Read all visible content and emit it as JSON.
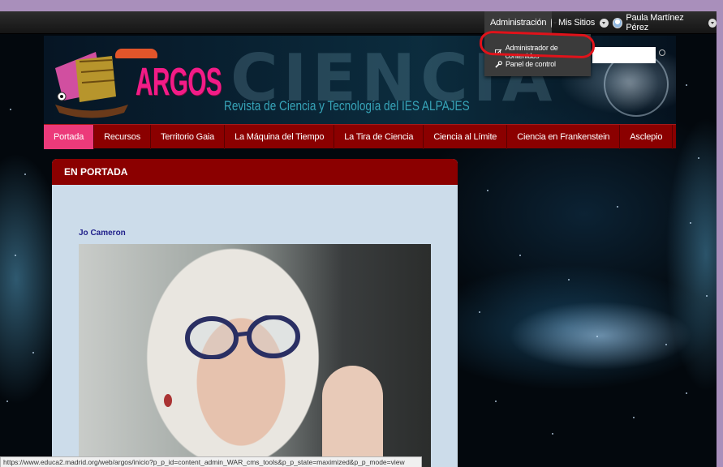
{
  "dockbar": {
    "admin_label": "Administración",
    "sites_label": "Mis Sitios",
    "user_name": "Paula Martínez Pérez"
  },
  "admin_menu": {
    "items": [
      {
        "label": "Administrador de contenidos",
        "icon": "edit-icon"
      },
      {
        "label": "Panel de control",
        "icon": "wrench-icon"
      }
    ]
  },
  "banner": {
    "logo": "ARGOS",
    "subtitle": "Revista de Ciencia y Tecnología del IES ALPAJES"
  },
  "nav": {
    "items": [
      {
        "label": "Portada",
        "active": true
      },
      {
        "label": "Recursos"
      },
      {
        "label": "Territorio Gaia"
      },
      {
        "label": "La Máquina del Tiempo"
      },
      {
        "label": "La Tira de Ciencia"
      },
      {
        "label": "Ciencia al Límite"
      },
      {
        "label": "Ciencia en Frankenstein"
      },
      {
        "label": "Asclepio"
      }
    ]
  },
  "main": {
    "section_title": "EN PORTADA",
    "article_title": "Jo Cameron"
  },
  "status_url": "https://www.educa2.madrid.org/web/argos/inicio?p_p_id=content_admin_WAR_cms_tools&p_p_state=maximized&p_p_mode=view",
  "colors": {
    "nav_bg": "#8b0000",
    "nav_active": "#ec3a7a",
    "highlight_circle": "#e0121a",
    "panel_bg": "#ccdcea"
  }
}
